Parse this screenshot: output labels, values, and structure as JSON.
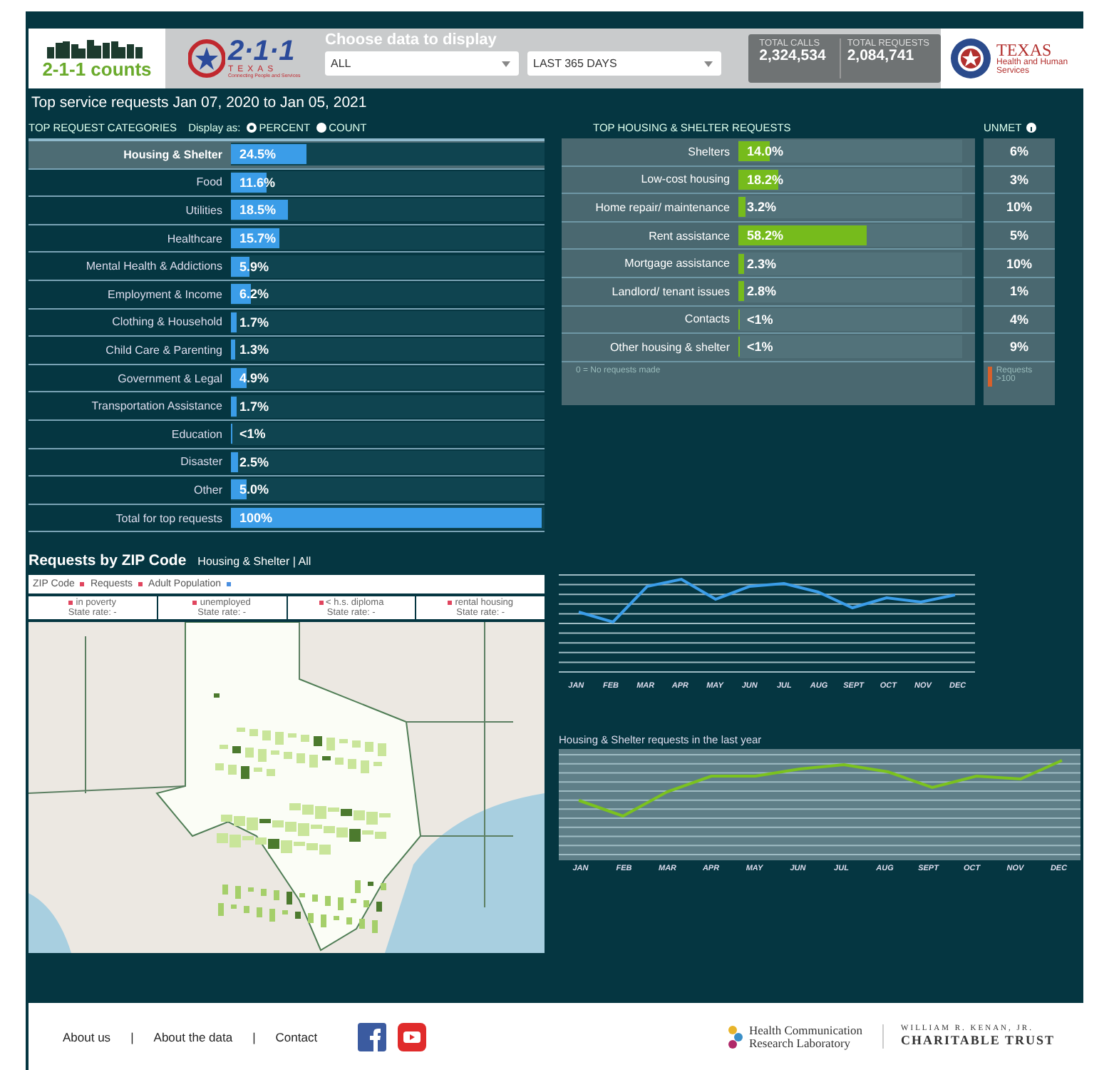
{
  "header": {
    "counts_logo": "2-1-1 counts",
    "texas211_logo": {
      "number": "2·1·1",
      "state": "TEXAS",
      "tagline": "Connecting People and Services"
    },
    "chooser": {
      "title": "Choose data to display",
      "selects": [
        {
          "value": "ALL"
        },
        {
          "value": "LAST 365 DAYS"
        }
      ]
    },
    "stats": [
      {
        "label": "TOTAL CALLS",
        "value": "2,324,534"
      },
      {
        "label": "TOTAL REQUESTS",
        "value": "2,084,741"
      }
    ],
    "hhs_logo": {
      "name": "TEXAS",
      "sub": "Health and Human Services"
    }
  },
  "subtitle": "Top service requests Jan 07, 2020 to Jan 05, 2021",
  "categories": {
    "heading": "TOP REQUEST CATEGORIES",
    "display_label": "Display as:",
    "display_options": [
      {
        "label": "PERCENT",
        "selected": true
      },
      {
        "label": "COUNT",
        "selected": false
      }
    ],
    "rows": [
      {
        "label": "Housing & Shelter",
        "value": "24.5%",
        "level": 0.245,
        "selected": true
      },
      {
        "label": "Food",
        "value": "11.6%",
        "level": 0.116,
        "selected": false
      },
      {
        "label": "Utilities",
        "value": "18.5%",
        "level": 0.185,
        "selected": false
      },
      {
        "label": "Healthcare",
        "value": "15.7%",
        "level": 0.157,
        "selected": false
      },
      {
        "label": "Mental Health & Addictions",
        "value": "5.9%",
        "level": 0.059,
        "selected": false
      },
      {
        "label": "Employment & Income",
        "value": "6.2%",
        "level": 0.062,
        "selected": false
      },
      {
        "label": "Clothing & Household",
        "value": "1.7%",
        "level": 0.017,
        "selected": false
      },
      {
        "label": "Child Care & Parenting",
        "value": "1.3%",
        "level": 0.013,
        "selected": false
      },
      {
        "label": "Government & Legal",
        "value": "4.9%",
        "level": 0.049,
        "selected": false
      },
      {
        "label": "Transportation Assistance",
        "value": "1.7%",
        "level": 0.017,
        "selected": false
      },
      {
        "label": "Education",
        "value": "<1%",
        "level": 0.005,
        "selected": false
      },
      {
        "label": "Disaster",
        "value": "2.5%",
        "level": 0.025,
        "selected": false
      },
      {
        "label": "Other",
        "value": "5.0%",
        "level": 0.05,
        "selected": false
      },
      {
        "label": "Total for top requests",
        "value": "100%",
        "level": 1,
        "selected": false
      }
    ]
  },
  "housing": {
    "heading": "TOP HOUSING & SHELTER REQUESTS",
    "unmet_heading": "UNMET",
    "rows": [
      {
        "label": "Shelters",
        "value": "14.0%",
        "level": 0.14,
        "unmet": "6%"
      },
      {
        "label": "Low-cost housing",
        "value": "18.2%",
        "level": 0.182,
        "unmet": "3%"
      },
      {
        "label": "Home repair/ maintenance",
        "value": "3.2%",
        "level": 0.032,
        "unmet": "10%"
      },
      {
        "label": "Rent assistance",
        "value": "58.2%",
        "level": 0.582,
        "unmet": "5%"
      },
      {
        "label": "Mortgage assistance",
        "value": "2.3%",
        "level": 0.023,
        "unmet": "10%"
      },
      {
        "label": "Landlord/ tenant issues",
        "value": "2.8%",
        "level": 0.028,
        "unmet": "1%"
      },
      {
        "label": "Contacts",
        "value": "<1%",
        "level": 0.005,
        "unmet": "4%"
      },
      {
        "label": "Other housing & shelter",
        "value": "<1%",
        "level": 0.005,
        "unmet": "9%"
      }
    ],
    "note": "0 = No requests made",
    "unmet_note": "Requests >100"
  },
  "zip": {
    "title": "Requests by ZIP Code",
    "filter": "Housing & Shelter | All",
    "legend": [
      {
        "label": "ZIP Code",
        "color": "#e0455e"
      },
      {
        "label": "Requests",
        "color": "#e0455e"
      },
      {
        "label": "Adult Population",
        "color": "#4a8fe0"
      }
    ],
    "rates": [
      {
        "label": "in poverty",
        "rate": "State rate: -",
        "color": "#e0455e"
      },
      {
        "label": "unemployed",
        "rate": "State rate: -",
        "color": "#e0455e"
      },
      {
        "label": "< h.s. diploma",
        "rate": "State rate: -",
        "color": "#e0455e"
      },
      {
        "label": "rental housing",
        "rate": "State rate: -",
        "color": "#e0455e"
      }
    ]
  },
  "charts": [
    {
      "months": [
        "JAN",
        "FEB",
        "MAR",
        "APR",
        "MAY",
        "JUN",
        "JUL",
        "AUG",
        "SEPT",
        "OCT",
        "NOV",
        "DEC"
      ]
    },
    {
      "title": "Housing & Shelter requests in the last year",
      "months": [
        "JAN",
        "FEB",
        "MAR",
        "APR",
        "MAY",
        "JUN",
        "JUL",
        "AUG",
        "SEPT",
        "OCT",
        "NOV",
        "DEC"
      ]
    }
  ],
  "footer": {
    "links": [
      "About us",
      "About the data",
      "Contact"
    ],
    "separator": "|",
    "hcrl": [
      "Health Communication",
      "Research Laboratory"
    ],
    "kenan": [
      "WILLIAM R. KENAN, JR.",
      "CHARITABLE TRUST"
    ]
  }
}
